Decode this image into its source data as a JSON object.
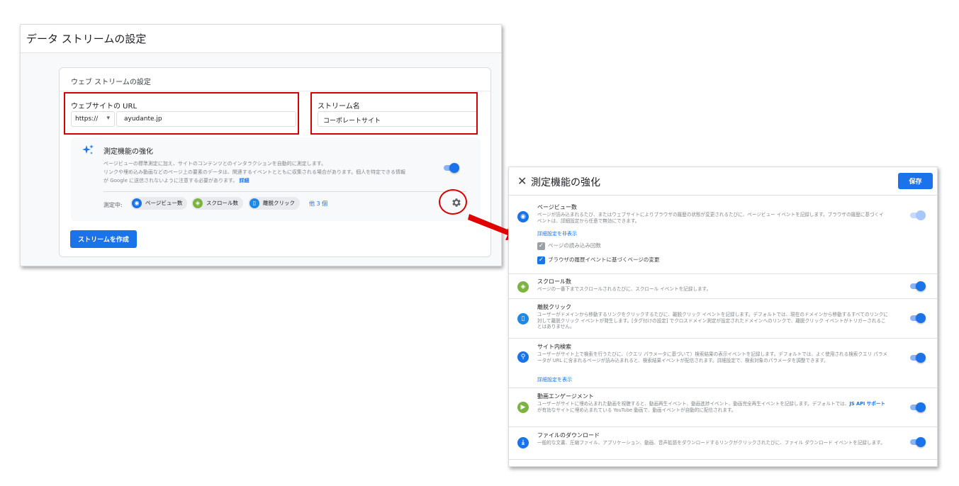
{
  "left": {
    "header_title": "データ ストリームの設定",
    "card_title": "ウェブ ストリームの設定",
    "url_label": "ウェブサイトの URL",
    "protocol_value": "https://",
    "url_value": "ayudante.jp",
    "stream_name_label": "ストリーム名",
    "stream_name_value": "コーポレートサイト",
    "enhanced_title": "測定機能の強化",
    "enhanced_desc_line1": "ページビューの標準測定に加え、サイトのコンテンツとのインタラクションを自動的に測定します。",
    "enhanced_desc_line2": "リンクや埋め込み動画などのページ上の要素のデータは、関連するイベントとともに収集される場合があります。個人を特定できる情報",
    "enhanced_desc_line3": "が Google に送信されないように注意する必要があります。",
    "enhanced_desc_link": "詳細",
    "measuring_label": "測定中:",
    "chips": [
      {
        "label": "ページビュー数",
        "icon": "eye-icon",
        "color": "#1a73e8"
      },
      {
        "label": "スクロール数",
        "icon": "scroll-icon",
        "color": "#7cb342"
      },
      {
        "label": "離脱クリック",
        "icon": "mouse-icon",
        "color": "#1e88e5"
      }
    ],
    "more_link": "他 3 個",
    "create_button": "ストリームを作成"
  },
  "right": {
    "title": "測定機能の強化",
    "save_label": "保存",
    "items": [
      {
        "title": "ページビュー数",
        "desc": "ページが読み込まれるたび、またはウェブサイトによりブラウザの履歴の状態が変更されるたびに、ページビュー イベントを記録します。ブラウザの履歴に基づくイベントは、詳細設定から任意で無効にできます。",
        "link": "詳細設定を非表示",
        "checkbox1": "ページの読み込み回数",
        "checkbox2": "ブラウザの履歴イベントに基づくページの変更",
        "icon": "eye-icon",
        "color": "#1a73e8",
        "enabled": true
      },
      {
        "title": "スクロール数",
        "desc": "ページの一番下までスクロールされるたびに、スクロール イベントを記録します。",
        "icon": "scroll-icon",
        "color": "#7cb342",
        "enabled": true
      },
      {
        "title": "離脱クリック",
        "desc": "ユーザーがドメインから移動するリンクをクリックするたびに、離脱クリック イベントを記録します。デフォルトでは、現在のドメインから移動するすべてのリンクに対して離脱クリック イベントが発生します。[タグ付けの設定] でクロスドメイン測定が設定されたドメインへのリンクで、離脱クリック イベントがトリガーされることはありません。",
        "icon": "mouse-icon",
        "color": "#1e88e5",
        "enabled": true
      },
      {
        "title": "サイト内検索",
        "desc": "ユーザーがサイト上で検索を行うたびに、（クエリ パラメータに基づいて）検索結果の表示イベントを記録します。デフォルトでは、よく使用される検索クエリ パラメータが URL に含まれるページが読み込まれると、検索結果イベントが配信されます。詳細設定で、検索対象のパラメータを調整できます。",
        "link": "詳細設定を表示",
        "icon": "search-icon",
        "color": "#1a73e8",
        "enabled": true
      },
      {
        "title": "動画エンゲージメント",
        "desc_before": "ユーザーがサイトに埋め込まれた動画を視聴すると、動画再生イベント、動画進捗イベント、動画完全再生イベントを記録します。デフォルトでは、",
        "desc_link": "JS API サポート",
        "desc_after": "が有効なサイトに埋め込まれている YouTube 動画で、動画イベントが自動的に配信されます。",
        "icon": "play-icon",
        "color": "#7cb342",
        "enabled": true
      },
      {
        "title": "ファイルのダウンロード",
        "desc": "一般的な文書、圧縮ファイル、アプリケーション、動画、音声拡張をダウンロードするリンクがクリックされたびに、ファイル ダウンロード イベントを記録します。",
        "icon": "download-icon",
        "color": "#1a73e8",
        "enabled": true
      }
    ]
  },
  "colors": {
    "accent": "#1a73e8",
    "highlight_red": "#d50000"
  }
}
